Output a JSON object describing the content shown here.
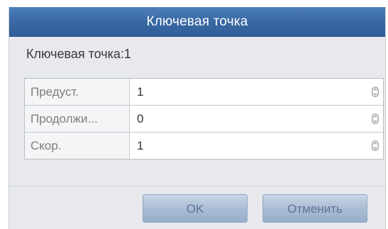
{
  "dialog": {
    "title": "Ключевая точка",
    "heading": "Ключевая точка:1",
    "rows": [
      {
        "label": "Предуст.",
        "value": "1"
      },
      {
        "label": "Продолжи...",
        "value": "0"
      },
      {
        "label": "Скор.",
        "value": "1"
      }
    ],
    "ok_label": "OK",
    "cancel_label": "Отменить"
  },
  "colors": {
    "title_bar": "#3a6aa5",
    "dialog_bg": "#e7e9ec",
    "button": "#a7bbd3"
  },
  "icons": {
    "spinner": "up-down-spinner-icon"
  }
}
